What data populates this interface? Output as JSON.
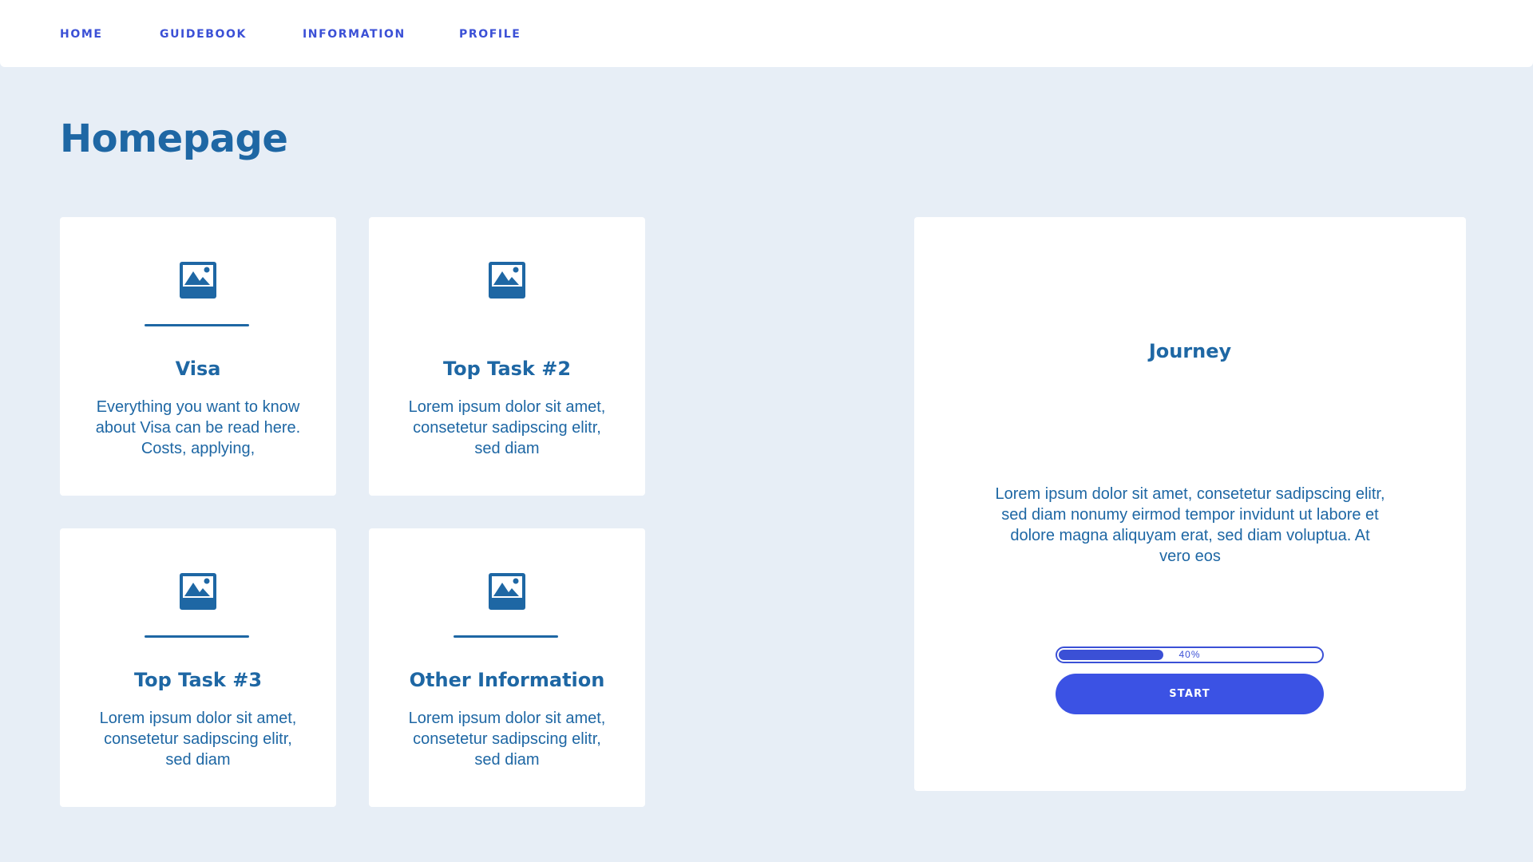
{
  "nav": {
    "items": [
      {
        "label": "HOME"
      },
      {
        "label": "GUIDEBOOK"
      },
      {
        "label": "INFORMATION"
      },
      {
        "label": "PROFILE"
      }
    ]
  },
  "page": {
    "title": "Homepage"
  },
  "cards": [
    {
      "title": "Visa",
      "description": "Everything you want to know about Visa can be read here. Costs, applying,",
      "icon": "image-icon"
    },
    {
      "title": "Top Task #2",
      "description": "Lorem ipsum dolor sit amet, consetetur sadipscing elitr, sed diam",
      "icon": "image-icon"
    },
    {
      "title": "Top Task #3",
      "description": "Lorem ipsum dolor sit amet, consetetur sadipscing elitr, sed diam",
      "icon": "image-icon"
    },
    {
      "title": "Other Information",
      "description": "Lorem ipsum dolor sit amet, consetetur sadipscing elitr, sed diam",
      "icon": "image-icon"
    }
  ],
  "journey": {
    "title": "Journey",
    "description": "Lorem ipsum dolor sit amet, consetetur sadipscing elitr, sed diam nonumy eirmod tempor invidunt ut labore et dolore magna aliquyam erat, sed diam voluptua. At vero eos",
    "progress_value": 0.4,
    "progress_label": "40%",
    "start_label": "START"
  },
  "colors": {
    "background": "#e7eef6",
    "primary_text": "#1e67a4",
    "accent": "#3b50d6"
  }
}
